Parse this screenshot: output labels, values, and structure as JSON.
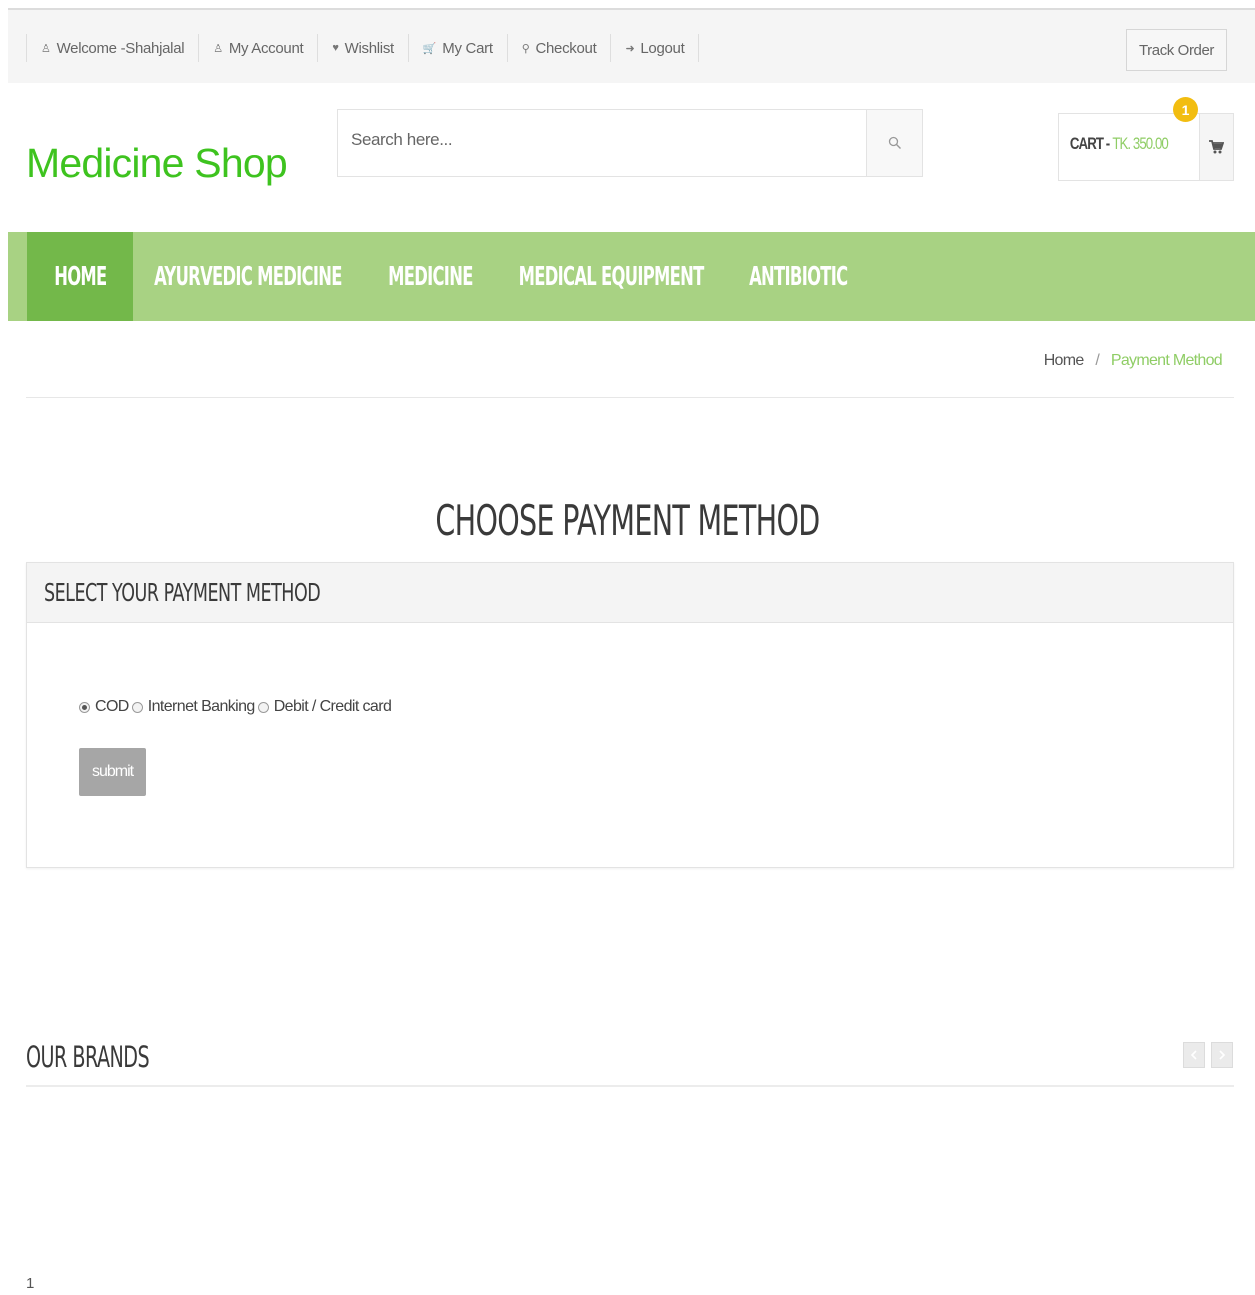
{
  "topbar": {
    "links": [
      {
        "label": "Welcome -Shahjalal",
        "icon": "user-icon"
      },
      {
        "label": "My Account",
        "icon": "user-icon"
      },
      {
        "label": "Wishlist",
        "icon": "heart-icon"
      },
      {
        "label": "My Cart",
        "icon": "cart-icon"
      },
      {
        "label": "Checkout",
        "icon": "key-icon"
      },
      {
        "label": "Logout",
        "icon": "logout-icon"
      }
    ],
    "track_order": "Track Order"
  },
  "header": {
    "logo": "Medicine Shop",
    "search_placeholder": "Search here...",
    "cart_label": "CART -",
    "cart_price": "TK. 350.00",
    "cart_count": "1"
  },
  "nav": {
    "items": [
      {
        "label": "HOME"
      },
      {
        "label": "AYURVEDIC MEDICINE"
      },
      {
        "label": "MEDICINE"
      },
      {
        "label": "MEDICAL EQUIPMENT"
      },
      {
        "label": "ANTIBIOTIC"
      }
    ]
  },
  "breadcrumb": {
    "home": "Home",
    "separator": "/",
    "current": "Payment Method"
  },
  "payment": {
    "title": "CHOOSE PAYMENT METHOD",
    "panel_heading": "SELECT YOUR PAYMENT METHOD",
    "options": [
      "COD",
      "Internet Banking",
      "Debit / Credit card"
    ],
    "selected": "COD",
    "submit_label": "submit"
  },
  "brands": {
    "title": "OUR BRANDS"
  },
  "footer": {
    "page_number": "1"
  },
  "colors": {
    "brand_green": "#3ec31f",
    "nav_green": "#a8d283",
    "nav_active": "#73b84a",
    "accent_green": "#8fcd65",
    "badge_yellow": "#f2bd10"
  }
}
